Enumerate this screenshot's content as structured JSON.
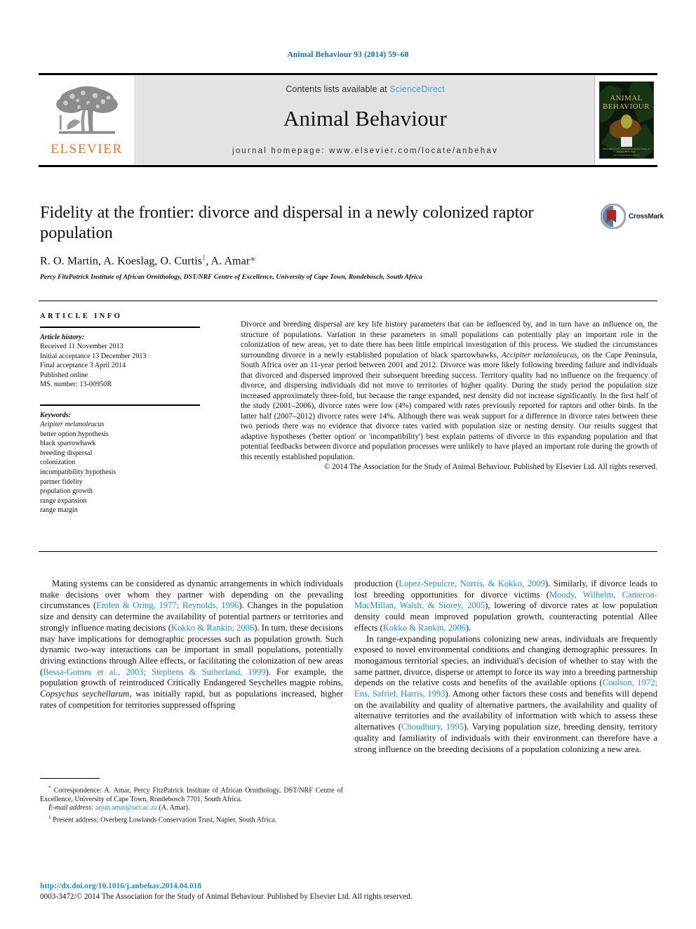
{
  "running_head": "Animal Behaviour 93 (2014) 59–68",
  "masthead": {
    "contents_prefix": "Contents lists available at ",
    "sciencedirect": "ScienceDirect",
    "journal_name": "Animal Behaviour",
    "homepage": "journal homepage: www.elsevier.com/locate/anbehav",
    "publisher_logo_text": "ELSEVIER",
    "cover": {
      "title_line1": "ANIMAL",
      "title_line2": "BEHAVIOUR",
      "footer_line1": "Published for the Association for the Study of Animal Behaviour",
      "footer_line2": "and the Animal Behavior Society"
    }
  },
  "crossmark": {
    "label": "CrossMark"
  },
  "article": {
    "title": "Fidelity at the frontier: divorce and dispersal in a newly colonized raptor population",
    "authors_plain": "R. O. Martin, A. Koeslag, O. Curtis 1, A. Amar*",
    "authors": [
      {
        "name": "R. O. Martin",
        "mark": ""
      },
      {
        "name": "A. Koeslag",
        "mark": ""
      },
      {
        "name": "O. Curtis",
        "mark": "1"
      },
      {
        "name": "A. Amar",
        "mark": "*"
      }
    ],
    "affiliation": "Percy FitzPatrick Institute of African Ornithology, DST/NRF Centre of Excellence, University of Cape Town, Rondebosch, South Africa"
  },
  "article_info": {
    "heading": "ARTICLE INFO",
    "history_label": "Article history:",
    "history": [
      "Received 11 November 2013",
      "Initial acceptance 13 December 2013",
      "Final acceptance 3 April 2014",
      "Published online",
      "MS. number: 13-00950R"
    ],
    "keywords_label": "Keywords:",
    "keywords": [
      "Acipiter melanoleucus",
      "better option hypothesis",
      "black sparrowhawk",
      "breeding dispersal",
      "colonization",
      "incompatibility hypothesis",
      "partner fidelity",
      "population growth",
      "range expansion",
      "range margin"
    ],
    "keywords_italic_first": true
  },
  "abstract": {
    "part1": "Divorce and breeding dispersal are key life history parameters that can be influenced by, and in turn have an influence on, the structure of populations. Variation in these parameters in small populations can potentially play an important role in the colonization of new areas, yet to date there has been little empirical investigation of this process. We studied the circumstances surrounding divorce in a newly established population of black sparrowhawks, ",
    "species": "Accipiter melanoleucus",
    "part2": ", on the Cape Peninsula, South Africa over an 11-year period between 2001 and 2012. Divorce was more likely following breeding failure and individuals that divorced and dispersed improved their subsequent breeding success. Territory quality had no influence on the frequency of divorce, and dispersing individuals did not move to territories of higher quality. During the study period the population size increased approximately three-fold, but because the range expanded, nest density did not increase significantly. In the first half of the study (2001–2006), divorce rates were low (4%) compared with rates previously reported for raptors and other birds. In the latter half (2007–2012) divorce rates were 14%. Although there was weak support for a difference in divorce rates between these two periods there was no evidence that divorce rates varied with population size or nesting density. Our results suggest that adaptive hypotheses ('better option' or 'incompatibility') best explain patterns of divorce in this expanding population and that potential feedbacks between divorce and population processes were unlikely to have played an important role during the growth of this recently established population.",
    "copyright": "© 2014 The Association for the Study of Animal Behaviour. Published by Elsevier Ltd. All rights reserved."
  },
  "body": {
    "left": {
      "p1_a": "Mating systems can be considered as dynamic arrangements in which individuals make decisions over whom they partner with depending on the prevailing circumstances (",
      "p1_ref1": "Emlen & Oring, 1977; Reynolds, 1996",
      "p1_b": "). Changes in the population size and density can determine the availability of potential partners or territories and strongly influence mating decisions (",
      "p1_ref2": "Kokko & Rankin, 2006",
      "p1_c": "). In turn, these decisions may have implications for demographic processes such as population growth. Such dynamic two-way interactions can be important in small populations, potentially driving extinctions through Allee effects, or facilitating the colonization of new areas (",
      "p1_ref3": "Bessa-Gomes et al., 2003; Stephens & Sutherland, 1999",
      "p1_d": "). For example, the population growth of reintroduced Critically Endangered Seychelles magpie robins, ",
      "p1_species": "Copsychus seychellarum",
      "p1_e": ", was initially rapid, but as populations increased, higher rates of competition for territories suppressed offspring"
    },
    "right": {
      "p1_a": "production (",
      "p1_ref1": "Lopez-Sepulcre, Norris, & Kokko, 2009",
      "p1_b": "). Similarly, if divorce leads to lost breeding opportunities for divorce victims (",
      "p1_ref2": "Moody, Wilhelm, Cameron-MacMillan, Walsh, & Storey, 2005",
      "p1_c": "), lowering of divorce rates at low population density could mean improved population growth, counteracting potential Allee effects (",
      "p1_ref3": "Kokko & Rankin, 2006",
      "p1_d": ").",
      "p2_a": "In range-expanding populations colonizing new areas, individuals are frequently exposed to novel environmental conditions and changing demographic pressures. In monogamous territorial species, an individual's decision of whether to stay with the same partner, divorce, disperse or attempt to force its way into a breeding partnership depends on the relative costs and benefits of the available options (",
      "p2_ref1": "Coulson, 1972; Ens, Safriel, Harris, 1993",
      "p2_b": "). Among other factors these costs and benefits will depend on the availability and quality of alternative partners, the availability and quality of alternative territories and the availability of information with which to assess these alternatives (",
      "p2_ref2": "Choudhury, 1995",
      "p2_c": "). Varying population size, breeding density, territory quality and familiarity of individuals with their environment can therefore have a strong influence on the breeding decisions of a population colonizing a new area."
    }
  },
  "footnotes": {
    "correspondence_mark": "*",
    "correspondence": " Correspondence: A. Amar, Percy FitzPatrick Institute of African Ornithology, DST/NRF Centre of Excellence, University of Cape Town, Rondebosch 7701, South Africa.",
    "email_label": "E-mail address:",
    "email": "arjun.amar@uct.ac.za",
    "email_suffix": " (A. Amar).",
    "present_address_mark": "1",
    "present_address": " Present address: Overberg Lowlands Conservation Trust, Napier, South Africa."
  },
  "footer": {
    "doi": "http://dx.doi.org/10.1016/j.anbehav.2014.04.018",
    "copyright": "0003-3472/© 2014 The Association for the Study of Animal Behaviour. Published by Elsevier Ltd. All rights reserved."
  },
  "colors": {
    "link_blue": "#1f8fc6",
    "header_blue": "#1070a8",
    "elsevier_orange": "#e87722",
    "masthead_grey": "#e3e3e3",
    "crossmark_red": "#b4241f"
  }
}
